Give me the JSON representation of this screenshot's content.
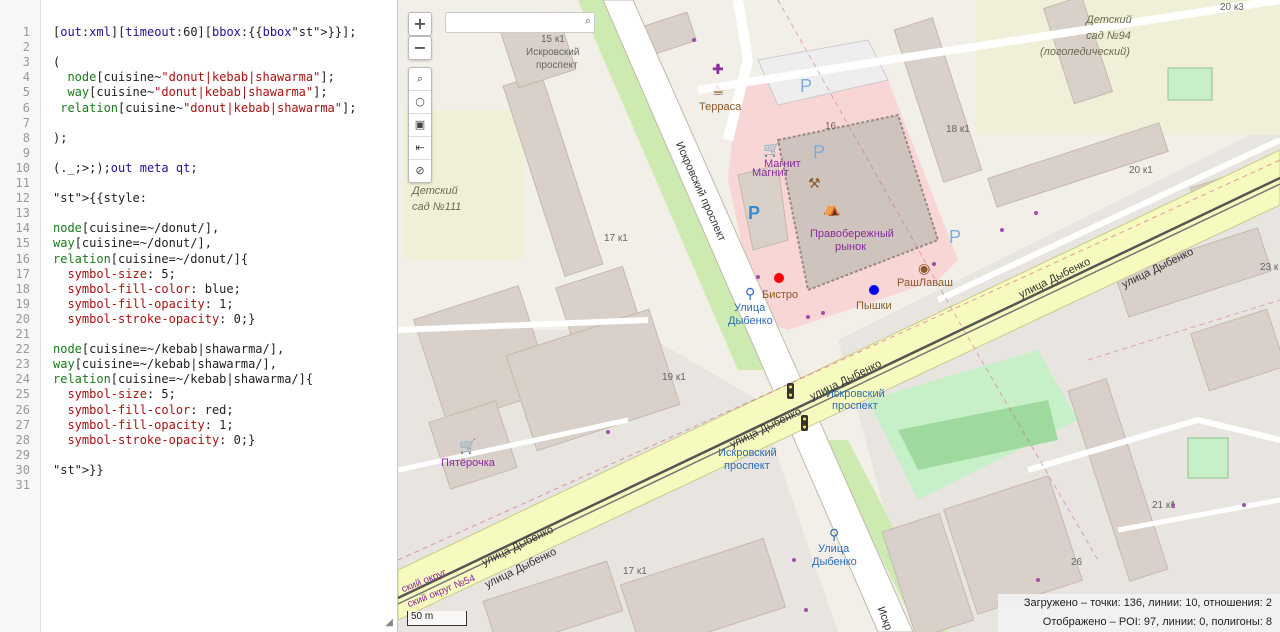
{
  "editor": {
    "lines": [
      "[out:xml][timeout:60][bbox:{{bbox}}];",
      "",
      "(",
      "  node[cuisine~\"donut|kebab|shawarma\"];",
      "  way[cuisine~\"donut|kebab|shawarma\"];",
      " relation[cuisine~\"donut|kebab|shawarma\"];",
      "",
      ");",
      "",
      "(._;>;);out meta qt;",
      "",
      "{{style:",
      "",
      "node[cuisine=~/donut/],",
      "way[cuisine=~/donut/],",
      "relation[cuisine=~/donut/]{",
      "  symbol-size: 5;",
      "  symbol-fill-color: blue;",
      "  symbol-fill-opacity: 1;",
      "  symbol-stroke-opacity: 0;}",
      "",
      "node[cuisine=~/kebab|shawarma/],",
      "way[cuisine=~/kebab|shawarma/],",
      "relation[cuisine=~/kebab|shawarma/]{",
      "  symbol-size: 5;",
      "  symbol-fill-color: red;",
      "  symbol-fill-opacity: 1;",
      "  symbol-stroke-opacity: 0;}",
      "",
      "}}",
      ""
    ]
  },
  "map": {
    "zoom_in": "+",
    "zoom_out": "−",
    "search_placeholder": "",
    "scale": "50 m",
    "status_line1": "Загружено – точки: 136, линии: 10, отношения: 2",
    "status_line2": "Отображено – POI: 97, линии: 0, полигоны: 8",
    "labels": {
      "kindergarten94_a": "Детский",
      "kindergarten94_b": "сад №94",
      "kindergarten94_c": "(логопедический)",
      "kindergarten111_a": "Детский",
      "kindergarten111_b": "сад №111",
      "iskrovsky_stop_top_a": "15 к1",
      "iskrovsky_stop_top_b": "Искровский",
      "iskrovsky_stop_top_c": "проспект",
      "terrasa": "Терраса",
      "magnit1": "Магнит",
      "magnit2": "Магнит",
      "market_a": "Правобережный",
      "market_b": "рынок",
      "bistro": "Бистро",
      "stop_dybenko_a": "Улица",
      "stop_dybenko_b": "Дыбенко",
      "pyshki": "Пышки",
      "rashlavash": "РашЛаваш",
      "pyaterochka": "Пятёрочка",
      "stop_iskr_mid_a": "Искровский",
      "stop_iskr_mid_b": "проспект",
      "stop_iskr_bot_a": "Искровский",
      "stop_iskr_bot_b": "проспект",
      "stop_dybenko2_a": "Улица",
      "stop_dybenko2_b": "Дыбенко",
      "street_iskr": "Искровский проспект",
      "street_iskr2": "Искр",
      "street_dyb1": "улица Дыбенко",
      "street_dyb2": "улица Дыбенко",
      "street_dyb3": "улица Дыбенко",
      "street_dyb4": "улица Дыбенко",
      "street_dyb5": "улица Дыбенко",
      "street_dyb6": "улица Дыбенко",
      "okrug": "ский округ",
      "okrug2": "ский округ №54",
      "h20k3": "20 к3",
      "h18k1": "18 к1",
      "h20k1": "20 к1",
      "h23k": "23 к",
      "h16": "16",
      "h17k1": "17 к1",
      "h19k1": "19 к1",
      "h21k1": "21 к1",
      "h26": "26",
      "h17k1b": "17 к1",
      "parking": "P"
    }
  }
}
